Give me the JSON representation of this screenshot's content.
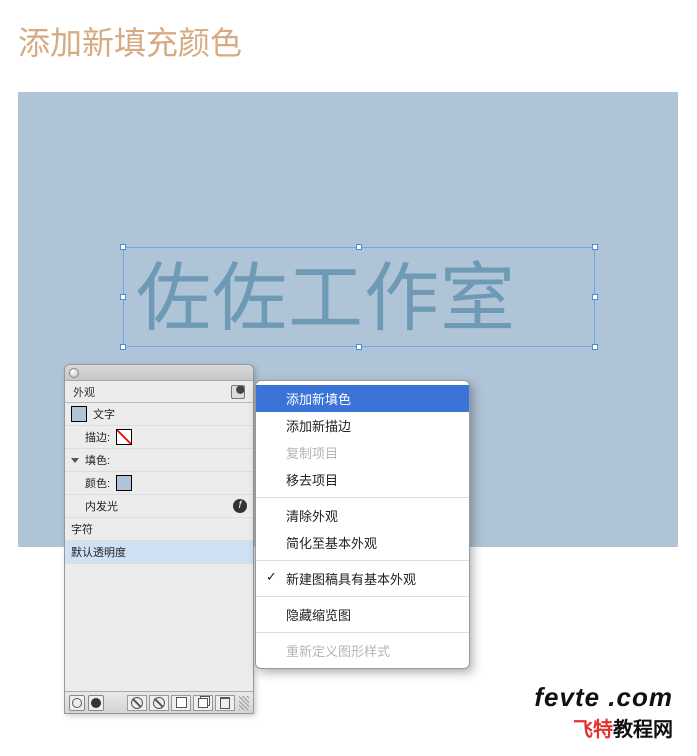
{
  "page": {
    "title": "添加新填充颜色"
  },
  "canvas": {
    "text": "佐佐工作室"
  },
  "panel": {
    "tab": "外观",
    "object_type": "文字",
    "stroke_label": "描边:",
    "fill_label": "填色:",
    "color_label": "颜色:",
    "inner_glow": "内发光",
    "chars": "字符",
    "opacity": "默认透明度"
  },
  "menu": {
    "items": [
      {
        "label": "添加新填色",
        "state": "active"
      },
      {
        "label": "添加新描边",
        "state": ""
      },
      {
        "label": "复制项目",
        "state": "disabled"
      },
      {
        "label": "移去项目",
        "state": ""
      },
      {
        "sep": true
      },
      {
        "label": "清除外观",
        "state": ""
      },
      {
        "label": "简化至基本外观",
        "state": ""
      },
      {
        "sep": true
      },
      {
        "label": "新建图稿具有基本外观",
        "state": "",
        "check": true
      },
      {
        "sep": true
      },
      {
        "label": "隐藏缩览图",
        "state": ""
      },
      {
        "sep": true
      },
      {
        "label": "重新定义图形样式",
        "state": "disabled"
      }
    ]
  },
  "watermark": {
    "domain": "fevte .com",
    "sub_red": "飞特",
    "sub_rest": "教程网"
  }
}
